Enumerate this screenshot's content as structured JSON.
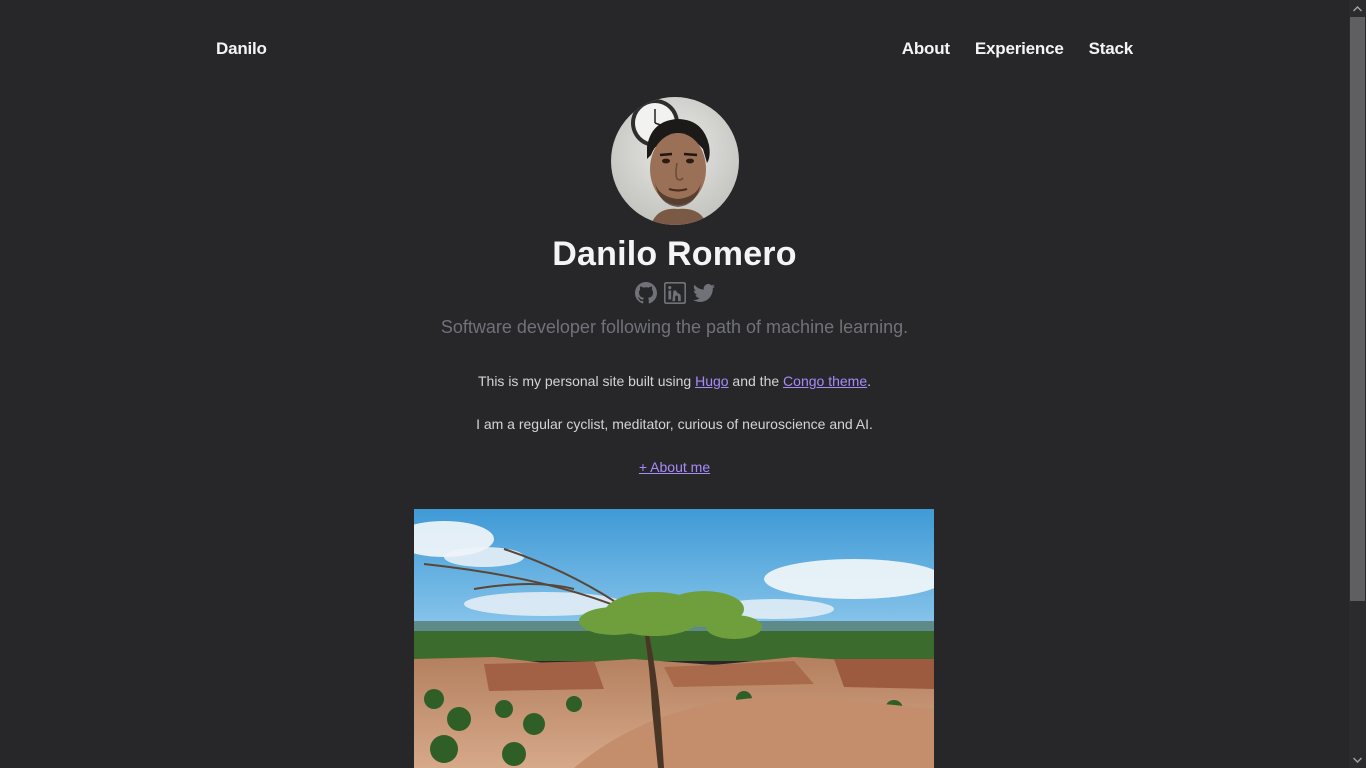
{
  "header": {
    "site_title": "Danilo",
    "nav": [
      {
        "label": "About"
      },
      {
        "label": "Experience"
      },
      {
        "label": "Stack"
      }
    ]
  },
  "profile": {
    "name": "Danilo Romero",
    "headline": "Software developer following the path of machine learning.",
    "socials": [
      {
        "icon": "github-icon"
      },
      {
        "icon": "linkedin-icon"
      },
      {
        "icon": "twitter-icon"
      }
    ]
  },
  "content": {
    "intro_prefix": "This is my personal site built using ",
    "hugo_link": "Hugo",
    "intro_middle": " and the ",
    "congo_link": "Congo theme",
    "intro_suffix": ".",
    "bio": "I am a regular cyclist, meditator, curious of neuroscience and AI.",
    "about_link": "+ About me"
  },
  "colors": {
    "background": "#27272a",
    "accent": "#a78bfa",
    "text": "#f4f4f5",
    "muted": "#71717a"
  }
}
